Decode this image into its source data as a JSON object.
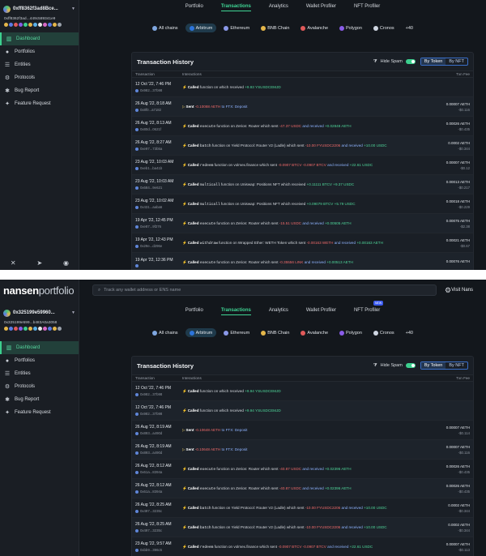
{
  "screen1": {
    "wallet": {
      "label": "0xff8362f3ad8Bce...",
      "address": "0xff8362f3ad...449c589341e9"
    },
    "tabs": [
      {
        "label": "Portfolio"
      },
      {
        "label": "Transactions"
      },
      {
        "label": "Analytics"
      },
      {
        "label": "Wallet Profiler"
      },
      {
        "label": "NFT Profiler"
      }
    ],
    "chains": [
      {
        "label": "All chains"
      },
      {
        "label": "Arbitrum"
      },
      {
        "label": "Ethereum"
      },
      {
        "label": "BNB Chain"
      },
      {
        "label": "Avalanche"
      },
      {
        "label": "Polygon"
      },
      {
        "label": "Cronos"
      },
      {
        "label": "+40"
      }
    ],
    "card": {
      "title": "Transaction History",
      "hide_spam": "Hide Spam",
      "by_token": "By Token",
      "by_nft": "By NFT"
    },
    "cols": {
      "c1": "Transaction",
      "c2": "Interactions",
      "c3": "Txn Fee"
    },
    "rows": [
      {
        "date": "12 Oct '22, 7:46 PM",
        "hash": "0x982...37b98",
        "verb": "Called",
        "pre": "",
        "fn": "",
        "mid": "function on which received",
        "neg": "",
        "mid2": "",
        "pos": "+9.93 YSUSDCEMJD",
        "fee": "",
        "usd": ""
      },
      {
        "date": "26 Aug '22, 8:18 AM",
        "hash": "0x8f0...a7182",
        "verb": "Sent",
        "pre": "",
        "fn": "",
        "mid": "",
        "neg": "-0.10088 AETH",
        "mid2": "to FTX: Deposit",
        "pos": "",
        "fee": "0.00007 AETH",
        "usd": "-$0.116"
      },
      {
        "date": "26 Aug '22, 8:13 AM",
        "hash": "0x80d...0621f",
        "verb": "Called",
        "pre": "",
        "fn": "execute",
        "mid": "function on Zerion: Router which sent",
        "neg": "-47.37 USDC",
        "mid2": "and received",
        "pos": "+0.02848 AETH",
        "fee": "0.00026 AETH",
        "usd": "-$0.435"
      },
      {
        "date": "26 Aug '22, 8:27 AM",
        "hash": "0xe97...73b5a",
        "verb": "Called",
        "pre": "",
        "fn": "batch",
        "mid": "function on Yield Protocol: Router V2 (Ladle) which sent",
        "neg": "-10.00 FYUSDC2206",
        "mid2": "and received",
        "pos": "+10.00 USDC",
        "fee": "0.0002 AETH",
        "usd": "-$0.344"
      },
      {
        "date": "23 Aug '22, 10:03 AM",
        "hash": "0xeb1...ba41b",
        "verb": "Called",
        "pre": "",
        "fn": "redeem",
        "mid": "function on volmex.finance which sent",
        "neg": "-0.0907 BTCV -0.0907 BTCV",
        "mid2": "and received",
        "pos": "+22.61 USDC",
        "fee": "0.00007 AETH",
        "usd": "-$0.12"
      },
      {
        "date": "23 Aug '22, 10:03 AM",
        "hash": "0x684...9e621",
        "verb": "Called",
        "pre": "",
        "fn": "multicall",
        "mid": "function on Uniswap: Positions NFT which received",
        "neg": "",
        "mid2": "",
        "pos": "+0.11111 BTCV +9.37 USDC",
        "fee": "0.00013 AETH",
        "usd": "-$0.217"
      },
      {
        "date": "23 Aug '22, 10:02 AM",
        "hash": "0x431...aaba6",
        "verb": "Called",
        "pre": "",
        "fn": "multicall",
        "mid": "function on Uniswap: Positions NFT which received",
        "neg": "",
        "mid2": "",
        "pos": "+0.09079 BTCV +5.79 USDC",
        "fee": "0.00018 AETH",
        "usd": "-$0.229"
      },
      {
        "date": "19 Apr '22, 12:45 PM",
        "hash": "0xe87...9f276",
        "verb": "Called",
        "pre": "",
        "fn": "execute",
        "mid": "function on Zerion: Router which sent",
        "neg": "-15.51 USDC",
        "mid2": "and received",
        "pos": "+0.00505 AETH",
        "fee": "0.00075 AETH",
        "usd": "-$2.38"
      },
      {
        "date": "19 Apr '22, 12:43 PM",
        "hash": "0x29e...d296e",
        "verb": "Called",
        "pre": "",
        "fn": "withdraw",
        "mid": "function on Wrapped Ether: WETH Token which sent",
        "neg": "-0.00163 WETH",
        "mid2": "and received",
        "pos": "+0.00163 AETH",
        "fee": "0.00021 AETH",
        "usd": "-$0.67"
      },
      {
        "date": "19 Apr '22, 12:36 PM",
        "hash": "",
        "verb": "Called",
        "pre": "",
        "fn": "execute",
        "mid": "function on Zerion: Router which sent",
        "neg": "-0.35556 LINK",
        "mid2": "and received",
        "pos": "+0.00513 AETH",
        "fee": "0.00076 AETH",
        "usd": ""
      }
    ]
  },
  "screen2": {
    "logo": {
      "brand": "nansen",
      "product": "portfolio"
    },
    "search_placeholder": "Track any wallet address or ENS name",
    "visit": "Visit Nans",
    "wallet": {
      "label": "0x325199e59960...",
      "address": "0x325199e599...b483A0a3058"
    },
    "tabs": [
      {
        "label": "Portfolio"
      },
      {
        "label": "Transactions"
      },
      {
        "label": "Analytics"
      },
      {
        "label": "Wallet Profiler"
      },
      {
        "label": "NFT Profiler",
        "badge": "NEW"
      }
    ],
    "chains": [
      {
        "label": "All chains"
      },
      {
        "label": "Arbitrum"
      },
      {
        "label": "Ethereum"
      },
      {
        "label": "BNB Chain"
      },
      {
        "label": "Avalanche"
      },
      {
        "label": "Polygon"
      },
      {
        "label": "Cronos"
      },
      {
        "label": "+40"
      }
    ],
    "card": {
      "title": "Transaction History",
      "hide_spam": "Hide Spam",
      "by_token": "By Token",
      "by_nft": "By NFT"
    },
    "cols": {
      "c1": "Transaction",
      "c2": "Interactions",
      "c3": "Txn Fee"
    },
    "rows": [
      {
        "date": "12 Oct '22, 7:46 PM",
        "hash": "0x982...37b98",
        "verb": "Called",
        "fn": "",
        "mid": "function on which received",
        "neg": "",
        "mid2": "",
        "pos": "+9.94 YSUSDCEMJD",
        "fee": "",
        "usd": ""
      },
      {
        "date": "12 Oct '22, 7:46 PM",
        "hash": "0x982...37b98",
        "verb": "Called",
        "fn": "",
        "mid": "function on which received",
        "neg": "",
        "mid2": "",
        "pos": "+9.94 YSUSDCEMJD",
        "fee": "",
        "usd": ""
      },
      {
        "date": "26 Aug '22, 8:19 AM",
        "hash": "0x893...a490d",
        "verb": "Sent",
        "fn": "",
        "mid": "",
        "neg": "-0.10648 AETH",
        "mid2": "to FTX: Deposit",
        "pos": "",
        "fee": "0.00007 AETH",
        "usd": "-$0.114"
      },
      {
        "date": "26 Aug '22, 8:19 AM",
        "hash": "0x893...a490d",
        "verb": "Sent",
        "fn": "",
        "mid": "",
        "neg": "-0.10648 AETH",
        "mid2": "to FTX: Deposit",
        "pos": "",
        "fee": "0.00007 AETH",
        "usd": "-$0.116"
      },
      {
        "date": "26 Aug '22, 8:12 AM",
        "hash": "0x61a...8394a",
        "verb": "Called",
        "fn": "execute",
        "mid": "function on Zerion: Router which sent",
        "neg": "-40.87 USDC",
        "mid2": "and received",
        "pos": "+0.02396 AETH",
        "fee": "0.00026 AETH",
        "usd": "-$0.435"
      },
      {
        "date": "26 Aug '22, 8:12 AM",
        "hash": "0x61a...8394a",
        "verb": "Called",
        "fn": "execute",
        "mid": "function on Zerion: Router which sent",
        "neg": "-40.87 USDC",
        "mid2": "and received",
        "pos": "+0.02396 AETH",
        "fee": "0.00026 AETH",
        "usd": "-$0.435"
      },
      {
        "date": "26 Aug '22, 8:25 AM",
        "hash": "0x497...3235c",
        "verb": "Called",
        "fn": "batch",
        "mid": "function on Yield Protocol: Router V2 (Ladle) which sent",
        "neg": "-10.00 FYUSDC2206",
        "mid2": "and received",
        "pos": "+10.00 USDC",
        "fee": "0.0002 AETH",
        "usd": "-$0.344"
      },
      {
        "date": "26 Aug '22, 8:25 AM",
        "hash": "0x497...3235c",
        "verb": "Called",
        "fn": "batch",
        "mid": "function on Yield Protocol: Router V2 (Ladle) which sent",
        "neg": "-10.00 FYUSDC2206",
        "mid2": "and received",
        "pos": "+10.00 USDC",
        "fee": "0.0002 AETH",
        "usd": "-$0.344"
      },
      {
        "date": "23 Aug '22, 9:57 AM",
        "hash": "0xbb9...396c5",
        "verb": "Called",
        "fn": "redeem",
        "mid": "function on volmex.finance which sent",
        "neg": "-0.0907 BTCV -0.0907 BTCV",
        "mid2": "and received",
        "pos": "+22.61 USDC",
        "fee": "0.00007 AETH",
        "usd": "-$0.113"
      }
    ]
  },
  "navitems": [
    {
      "label": "Dashboard"
    },
    {
      "label": "Portfolios"
    },
    {
      "label": "Entities"
    },
    {
      "label": "Protocols"
    },
    {
      "label": "Bug Report"
    },
    {
      "label": "Feature Request"
    }
  ],
  "icons": {
    "dashboard": "chart-bars-icon",
    "portfolios": "user-icon",
    "entities": "users-icon",
    "protocols": "gear-icon",
    "bug": "bug-icon",
    "feature": "bulb-icon"
  },
  "colors": {
    "accent": "#3ccf8e",
    "negative": "#ef6a6a",
    "positive": "#4fd69a",
    "selected_chain": "#1f3a4b"
  }
}
